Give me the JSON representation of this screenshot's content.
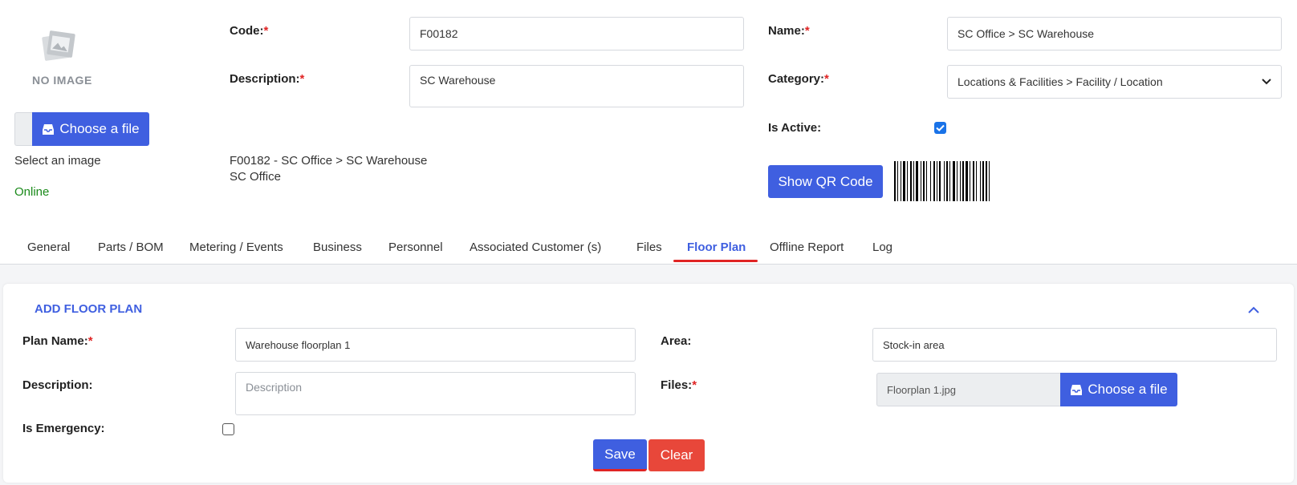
{
  "image_panel": {
    "no_image_text": "NO IMAGE",
    "choose_file_label": "Choose a file",
    "select_image_text": "Select an image",
    "status_text": "Online",
    "status_color": "#1a8a1a"
  },
  "form": {
    "code_label": "Code:",
    "code_value": "F00182",
    "description_label": "Description:",
    "description_value": "SC Warehouse",
    "name_label": "Name:",
    "name_value": "SC Office > SC Warehouse",
    "category_label": "Category:",
    "category_value": "Locations & Facilities > Facility / Location",
    "is_active_label": "Is Active:",
    "is_active_checked": true,
    "summary_line1": "F00182 - SC Office > SC Warehouse",
    "summary_line2": "SC Office",
    "show_qr_label": "Show QR Code",
    "required_mark": "*"
  },
  "tabs": [
    {
      "label": "General",
      "active": false
    },
    {
      "label": "Parts / BOM",
      "active": false
    },
    {
      "label": "Metering / Events",
      "active": false
    },
    {
      "label": "Business",
      "active": false
    },
    {
      "label": "Personnel",
      "active": false
    },
    {
      "label": "Associated Customer (s)",
      "active": false
    },
    {
      "label": "Files",
      "active": false
    },
    {
      "label": "Floor Plan",
      "active": true
    },
    {
      "label": "Offline Report",
      "active": false
    },
    {
      "label": "Log",
      "active": false
    }
  ],
  "floor_plan": {
    "section_title": "ADD FLOOR PLAN",
    "plan_name_label": "Plan Name:",
    "plan_name_value": "Warehouse floorplan 1",
    "area_label": "Area:",
    "area_value": "Stock-in area",
    "description_label": "Description:",
    "description_placeholder": "Description",
    "files_label": "Files:",
    "file_name": "Floorplan 1.jpg",
    "choose_file_label": "Choose a file",
    "is_emergency_label": "Is Emergency:",
    "is_emergency_checked": false,
    "save_label": "Save",
    "clear_label": "Clear"
  },
  "colors": {
    "accent": "#3f5fe0",
    "danger": "#e8473a",
    "required": "#e02424"
  }
}
